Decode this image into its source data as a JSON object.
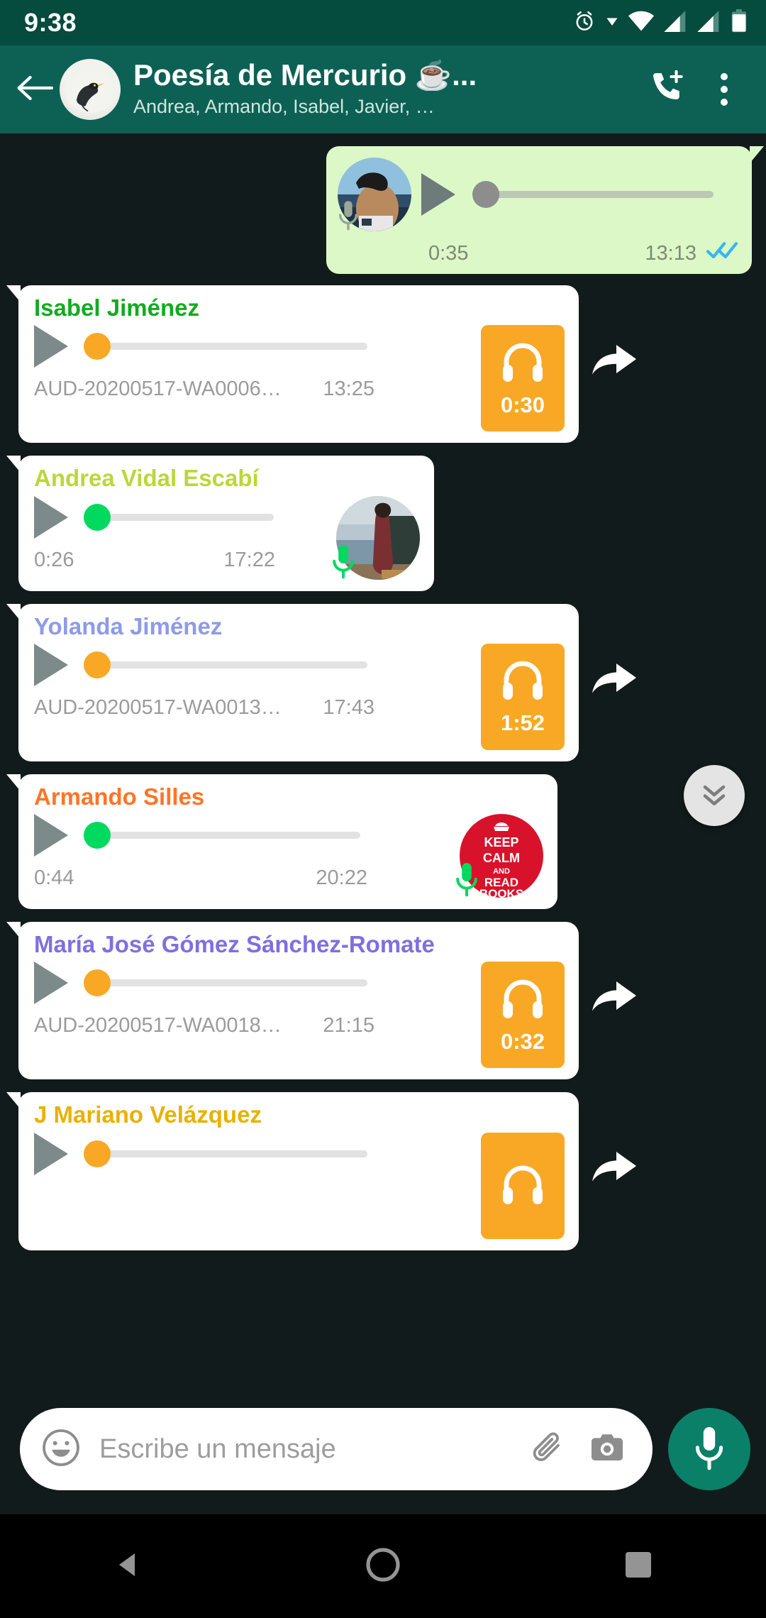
{
  "status_bar": {
    "clock": "9:38",
    "icons": [
      "alarm-icon",
      "dropdown-caret-icon",
      "wifi-icon",
      "signal-1-icon",
      "signal-2-icon",
      "battery-icon"
    ]
  },
  "app_bar": {
    "back_icon": "back-arrow-icon",
    "avatar": "group-avatar-blackbird",
    "title": "Poesía de Mercurio ☕...",
    "subtitle": "Andrea, Armando, Isabel, Javier, …",
    "call_icon": "phone-add-icon",
    "menu_icon": "overflow-menu-icon"
  },
  "colors": {
    "statusbar": "#054b3e",
    "appbar": "#0c6154",
    "chat_background": "#121b1b",
    "outgoing_bubble": "#dcf8c6",
    "incoming_bubble": "#ffffff",
    "badge_orange": "#f9a825",
    "knob_green": "#00d95f",
    "knob_orange": "#f9a825",
    "ticks_blue": "#34b7f1",
    "fab_teal": "#0a8069"
  },
  "messages": [
    {
      "id": "msg-outgoing-voice",
      "direction": "outgoing",
      "sender": null,
      "sender_color": null,
      "duration": "0:35",
      "time": "13:13",
      "progress_percent": 2,
      "knob_color": "#8d8d8d",
      "ticks": "double-blue-check",
      "profile_pic": "sender-photo-beach",
      "mic_badge": true,
      "forward": false
    },
    {
      "id": "msg-isabel",
      "direction": "incoming",
      "sender": "Isabel Jiménez",
      "sender_color": "#12ab20",
      "filename": "AUD-20200517-WA0006…",
      "time": "13:25",
      "badge_duration": "0:30",
      "badge_icon": "headphones-icon",
      "progress_percent": 3,
      "knob_color": "#f9a825",
      "forward": true
    },
    {
      "id": "msg-andrea",
      "direction": "incoming",
      "sender": "Andrea Vidal Escabí",
      "sender_color": "#bdd63a",
      "duration": "0:26",
      "time": "17:22",
      "progress_percent": 3,
      "knob_color": "#00d95f",
      "profile_pic": "sender-photo-kitchen",
      "mic_badge": true,
      "forward": false
    },
    {
      "id": "msg-yolanda",
      "direction": "incoming",
      "sender": "Yolanda Jiménez",
      "sender_color": "#8e9ae8",
      "filename": "AUD-20200517-WA0013…",
      "time": "17:43",
      "badge_duration": "1:52",
      "badge_icon": "headphones-icon",
      "progress_percent": 3,
      "knob_color": "#f9a825",
      "forward": true
    },
    {
      "id": "msg-armando",
      "direction": "incoming",
      "sender": "Armando Silles",
      "sender_color": "#ff7527",
      "duration": "0:44",
      "time": "20:22",
      "progress_percent": 3,
      "knob_color": "#00d95f",
      "profile_pic": "sender-photo-keep-calm",
      "profile_pic_text": [
        "KEEP",
        "CALM",
        "AND",
        "READ",
        "BOOKS"
      ],
      "mic_badge": true,
      "forward": false
    },
    {
      "id": "msg-maria-jose",
      "direction": "incoming",
      "sender": "María José Gómez Sánchez-Romate",
      "sender_color": "#7f6fe0",
      "filename": "AUD-20200517-WA0018…",
      "time": "21:15",
      "badge_duration": "0:32",
      "badge_icon": "headphones-icon",
      "progress_percent": 3,
      "knob_color": "#f9a825",
      "forward": true
    },
    {
      "id": "msg-mariano",
      "direction": "incoming",
      "sender": "J Mariano Velázquez",
      "sender_color": "#e8b100",
      "badge_icon": "headphones-icon",
      "progress_percent": 3,
      "knob_color": "#f9a825",
      "forward": true,
      "clipped": true
    }
  ],
  "scroll_button": {
    "icon": "chevron-double-down-icon"
  },
  "composer": {
    "emoji_icon": "emoji-smiley-icon",
    "placeholder": "Escribe un mensaje",
    "attach_icon": "paperclip-icon",
    "camera_icon": "camera-icon",
    "mic_icon": "microphone-icon"
  },
  "nav_bar": {
    "back_icon": "nav-back-triangle-icon",
    "home_icon": "nav-home-circle-icon",
    "recents_icon": "nav-recents-square-icon"
  }
}
